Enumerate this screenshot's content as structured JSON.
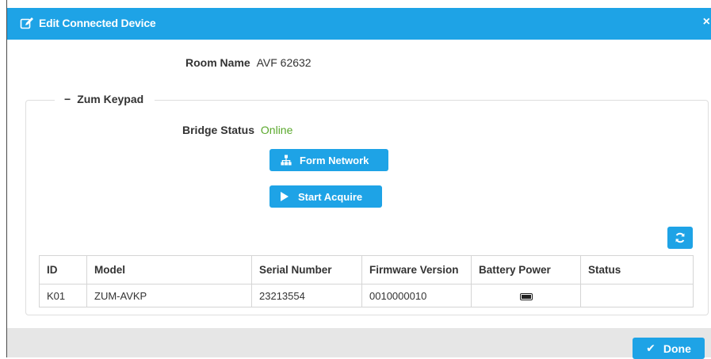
{
  "dialog": {
    "title": "Edit Connected Device",
    "title_icon": "edit-icon",
    "close_label": "×"
  },
  "room": {
    "label": "Room Name",
    "value": "AVF 62632"
  },
  "group": {
    "collapse_glyph": "−",
    "title": "Zum Keypad"
  },
  "bridge": {
    "label": "Bridge Status",
    "value": "Online"
  },
  "buttons": {
    "form_network": "Form Network",
    "start_acquire": "Start Acquire",
    "refresh_icon": "refresh-icon",
    "done": "Done"
  },
  "table": {
    "headers": [
      "ID",
      "Model",
      "Serial Number",
      "Firmware Version",
      "Battery Power",
      "Status"
    ],
    "rows": [
      {
        "id": "K01",
        "model": "ZUM-AVKP",
        "serial": "23213554",
        "firmware": "0010000010",
        "battery": "battery-full-icon",
        "status": ""
      }
    ]
  },
  "colors": {
    "accent": "#1ea3e6",
    "online": "#5aa82c",
    "footer": "#e6e6e6"
  }
}
